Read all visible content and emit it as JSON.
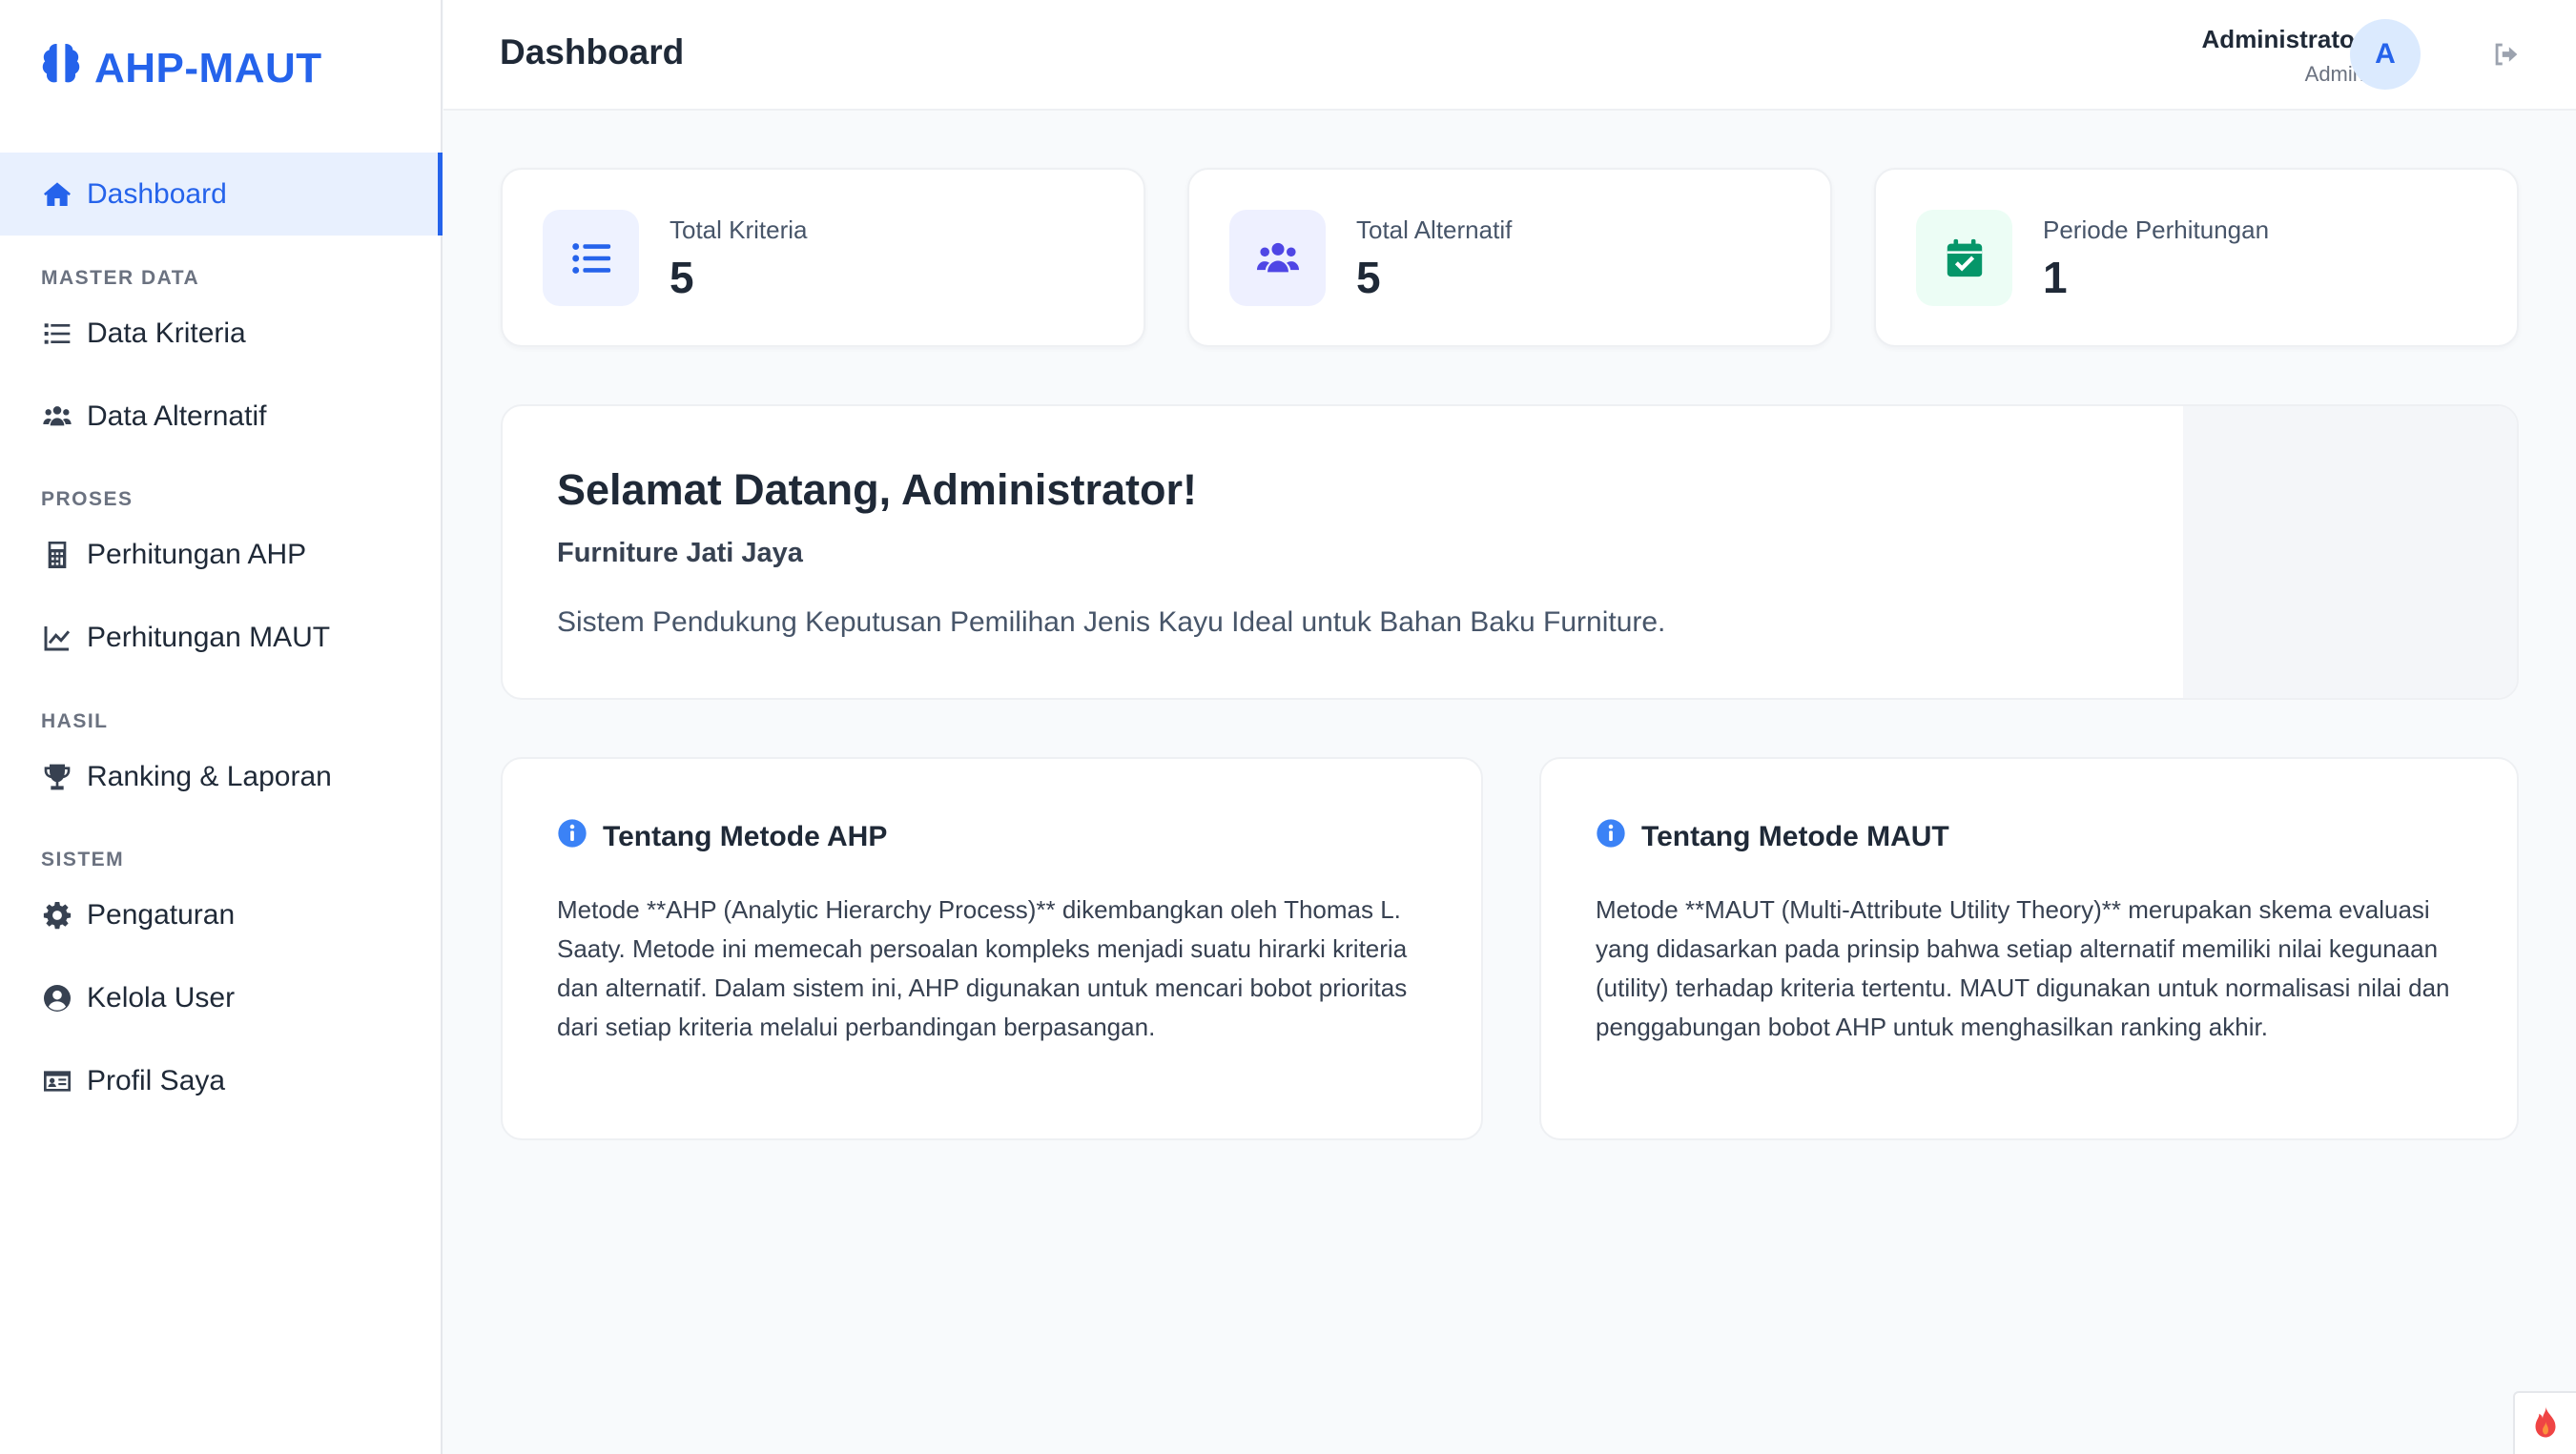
{
  "app": {
    "name": "AHP-MAUT",
    "brand_color": "#2563eb"
  },
  "sidebar": {
    "dashboard": "Dashboard",
    "sections": {
      "master": "MASTER DATA",
      "proses": "PROSES",
      "hasil": "HASIL",
      "sistem": "SISTEM"
    },
    "items": {
      "kriteria": "Data Kriteria",
      "alternatif": "Data Alternatif",
      "ahp": "Perhitungan AHP",
      "maut": "Perhitungan MAUT",
      "ranking": "Ranking & Laporan",
      "pengaturan": "Pengaturan",
      "user": "Kelola User",
      "profil": "Profil Saya"
    }
  },
  "header": {
    "title": "Dashboard",
    "user_name": "Administrator",
    "user_role": "Admin",
    "avatar_initial": "A"
  },
  "stats": [
    {
      "label": "Total Kriteria",
      "value": "5",
      "icon": "list-icon",
      "color": "#2563eb"
    },
    {
      "label": "Total Alternatif",
      "value": "5",
      "icon": "users-icon",
      "color": "#4f46e5"
    },
    {
      "label": "Periode Perhitungan",
      "value": "1",
      "icon": "calendar-check-icon",
      "color": "#059669"
    }
  ],
  "welcome": {
    "title": "Selamat Datang, Administrator!",
    "subtitle": "Furniture Jati Jaya",
    "description": "Sistem Pendukung Keputusan Pemilihan Jenis Kayu Ideal untuk Bahan Baku Furniture."
  },
  "info": {
    "ahp": {
      "title": "Tentang Metode AHP",
      "text": "Metode **AHP (Analytic Hierarchy Process)** dikembangkan oleh Thomas L. Saaty. Metode ini memecah persoalan kompleks menjadi suatu hirarki kriteria dan alternatif. Dalam sistem ini, AHP digunakan untuk mencari bobot prioritas dari setiap kriteria melalui perbandingan berpasangan."
    },
    "maut": {
      "title": "Tentang Metode MAUT",
      "text": "Metode **MAUT (Multi-Attribute Utility Theory)** merupakan skema evaluasi yang didasarkan pada prinsip bahwa setiap alternatif memiliki nilai kegunaan (utility) terhadap kriteria tertentu. MAUT digunakan untuk normalisasi nilai dan penggabungan bobot AHP untuk menghasilkan ranking akhir."
    }
  }
}
